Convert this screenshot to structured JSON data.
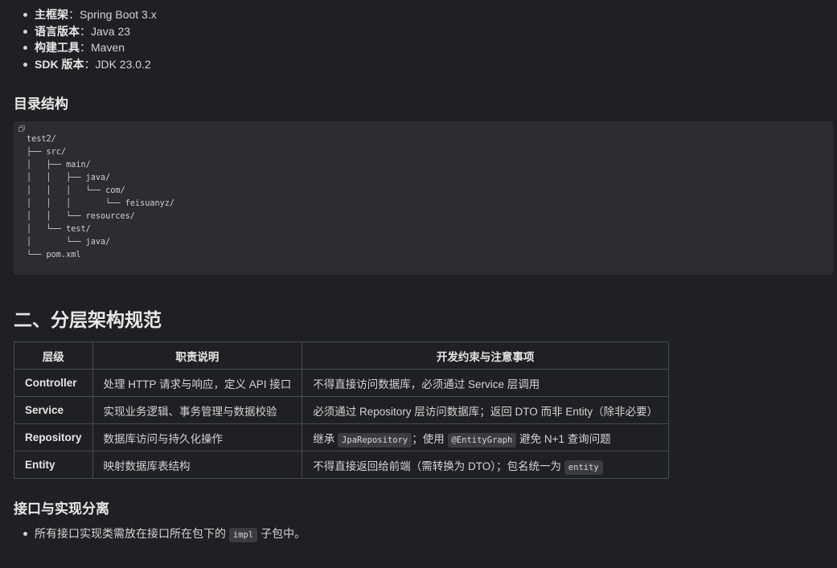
{
  "tech_stack": [
    {
      "label": "主框架",
      "value": "Spring Boot 3.x"
    },
    {
      "label": "语言版本",
      "value": "Java 23"
    },
    {
      "label": "构建工具",
      "value": "Maven"
    },
    {
      "label": "SDK 版本",
      "value": "JDK 23.0.2"
    }
  ],
  "colon": "：",
  "directory_heading": "目录结构",
  "directory_tree": "test2/\n├── src/\n│   ├── main/\n│   │   ├── java/\n│   │   │   └── com/\n│   │   │       └── feisuanyz/\n│   │   └── resources/\n│   └── test/\n│       └── java/\n└── pom.xml",
  "section2_title": "二、分层架构规范",
  "table": {
    "headers": [
      "层级",
      "职责说明",
      "开发约束与注意事项"
    ],
    "rows": [
      {
        "layer": "Controller",
        "duty": "处理 HTTP 请求与响应，定义 API 接口",
        "constraint_text": "不得直接访问数据库，必须通过 Service 层调用"
      },
      {
        "layer": "Service",
        "duty": "实现业务逻辑、事务管理与数据校验",
        "constraint_text": "必须通过 Repository 层访问数据库；返回 DTO 而非 Entity（除非必要）"
      },
      {
        "layer": "Repository",
        "duty": "数据库访问与持久化操作",
        "c_pre": "继承 ",
        "c_code1": "JpaRepository",
        "c_mid": "；使用 ",
        "c_code2": "@EntityGraph",
        "c_post": " 避免 N+1 查询问题"
      },
      {
        "layer": "Entity",
        "duty": "映射数据库表结构",
        "c_pre": "不得直接返回给前端（需转换为 DTO）；包名统一为 ",
        "c_code1": "entity"
      }
    ]
  },
  "interface_heading": "接口与实现分离",
  "interface_bullet": {
    "pre": "所有接口实现类需放在接口所在包下的 ",
    "code": "impl",
    "post": " 子包中。"
  }
}
